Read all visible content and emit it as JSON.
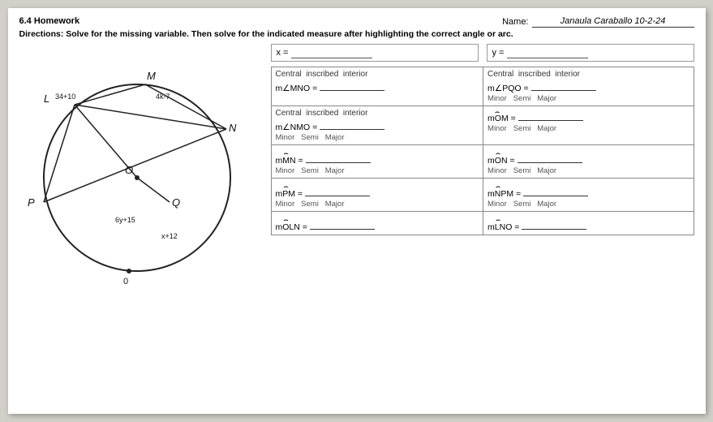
{
  "header": {
    "title": "6.4 Homework",
    "name_label": "Name:",
    "name_value": "Janaula  Caraballo  10-2-24",
    "directions": "Directions: Solve for the missing variable. Then solve for the indicated measure after highlighting the correct angle or arc."
  },
  "xy_row": {
    "x_label": "x =",
    "y_label": "y ="
  },
  "diagram": {
    "labels": {
      "L": "L",
      "angle_L": "34+10",
      "M": "M",
      "angle_M": "4k-7",
      "N": "N",
      "Q": "Q",
      "P": "P",
      "O": "O",
      "angle_Q": "6y+15",
      "angle_x": "x+12"
    }
  },
  "cells": [
    {
      "col": 0,
      "row": 0,
      "header": "Central  inscribed  interior",
      "eq_label": "m∠MNO =",
      "options": ""
    },
    {
      "col": 1,
      "row": 0,
      "header": "Central  inscribed  interior",
      "eq_label": "m∠PQO =",
      "options": ""
    },
    {
      "col": 0,
      "row": 1,
      "header": "Central  inscribed  interior",
      "eq_label": "m∠NMO =",
      "options": "Minor   Semi   Major"
    },
    {
      "col": 1,
      "row": 1,
      "header": "",
      "eq_label": "mOM =",
      "arc": true,
      "options": "Minor   Semi   Major"
    },
    {
      "col": 0,
      "row": 2,
      "header": "",
      "eq_label": "mMN =",
      "arc": true,
      "options": "Minor   Semi   Major"
    },
    {
      "col": 1,
      "row": 2,
      "header": "",
      "eq_label": "mON =",
      "arc": true,
      "options": "Minor   Semi   Major"
    },
    {
      "col": 0,
      "row": 3,
      "header": "",
      "eq_label": "mPM =",
      "arc": true,
      "options": "Minor   Semi   Major"
    },
    {
      "col": 1,
      "row": 3,
      "header": "",
      "eq_label": "mNPM =",
      "arc": true,
      "options": "Minor   Semi   Major"
    },
    {
      "col": 0,
      "row": 4,
      "header": "",
      "eq_label": "mOLN =",
      "arc": true,
      "options": ""
    },
    {
      "col": 1,
      "row": 4,
      "header": "",
      "eq_label": "mLNO =",
      "arc": true,
      "options": ""
    }
  ]
}
